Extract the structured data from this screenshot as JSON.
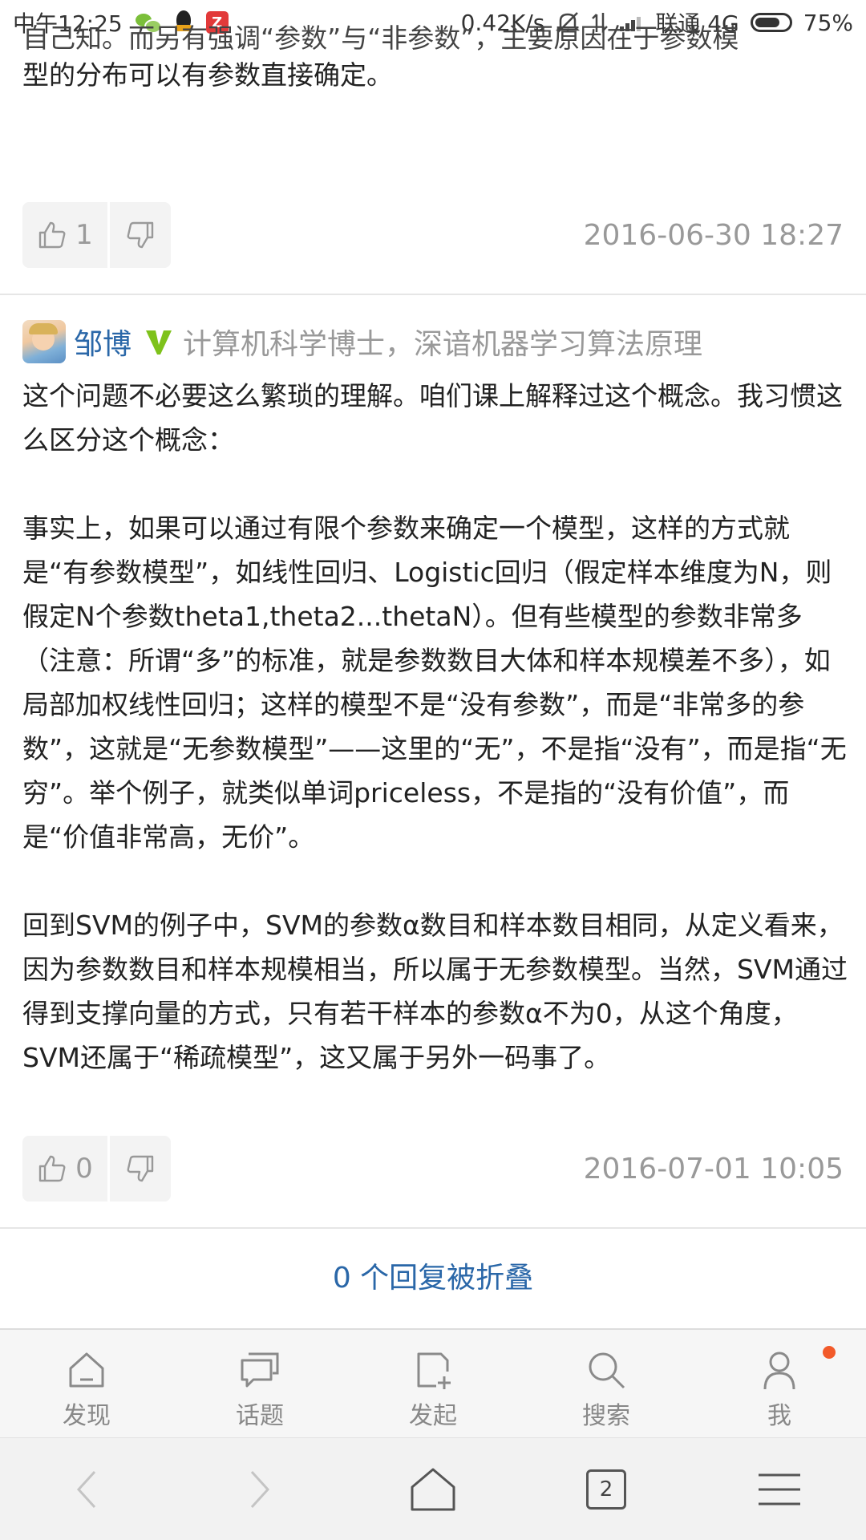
{
  "status_bar": {
    "time": "中午12:25",
    "app_badge": "Z",
    "net_speed": "0.42K/s",
    "carrier": "联通 4G",
    "battery": "75%"
  },
  "top_partial": {
    "cut_line": "自己知。而另有强调“参数”与“非参数”，主要原因在于参数模",
    "last_line": "型的分布可以有参数直接确定。"
  },
  "answer1_actions": {
    "upvotes": "1",
    "timestamp": "2016-06-30 18:27"
  },
  "answer2": {
    "author_name": "邹博",
    "author_bio": "计算机科学博士，深谙机器学习算法原理",
    "paragraphs": [
      "这个问题不必要这么繁琐的理解。咱们课上解释过这个概念。我习惯这么区分这个概念：",
      "事实上，如果可以通过有限个参数来确定一个模型，这样的方式就是“有参数模型”，如线性回归、Logistic回归（假定样本维度为N，则假定N个参数theta1,theta2...thetaN）。但有些模型的参数非常多（注意：所谓“多”的标准，就是参数数目大体和样本规模差不多），如局部加权线性回归；这样的模型不是“没有参数”，而是“非常多的参数”，这就是“无参数模型”——这里的“无”，不是指“没有”，而是指“无穷”。举个例子，就类似单词priceless，不是指的“没有价值”，而是“价值非常高，无价”。",
      "回到SVM的例子中，SVM的参数α数目和样本数目相同，从定义看来，因为参数数目和样本规模相当，所以属于无参数模型。当然，SVM通过得到支撑向量的方式，只有若干样本的参数α不为0，从这个角度，SVM还属于“稀疏模型”，这又属于另外一码事了。"
    ],
    "upvotes": "0",
    "timestamp": "2016-07-01 10:05"
  },
  "collapsed_replies": "0 个回复被折叠",
  "tabbar": {
    "items": [
      {
        "label": "发现",
        "icon": "home-icon"
      },
      {
        "label": "话题",
        "icon": "chat-icon"
      },
      {
        "label": "发起",
        "icon": "compose-icon"
      },
      {
        "label": "搜索",
        "icon": "search-icon"
      },
      {
        "label": "我",
        "icon": "user-icon"
      }
    ]
  },
  "browser_nav": {
    "tab_count": "2"
  },
  "colors": {
    "link_blue": "#2a67a8",
    "notify_dot": "#f25a2a",
    "verified_green": "#7ec21b"
  }
}
